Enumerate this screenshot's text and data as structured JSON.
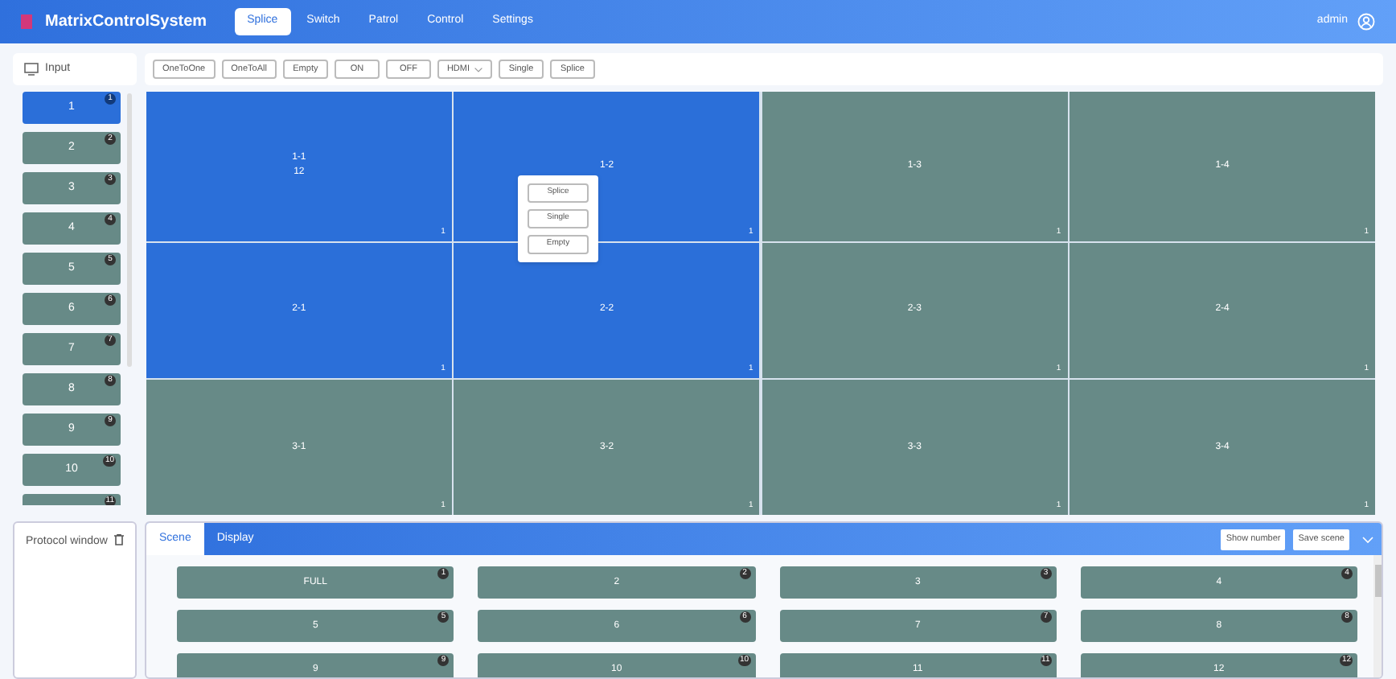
{
  "header": {
    "title": "MatrixControlSystem",
    "tabs": [
      {
        "label": "Splice",
        "selected": true
      },
      {
        "label": "Switch",
        "selected": false
      },
      {
        "label": "Patrol",
        "selected": false
      },
      {
        "label": "Control",
        "selected": false
      },
      {
        "label": "Settings",
        "selected": false
      }
    ],
    "user": "admin"
  },
  "input_panel": {
    "title": "Input",
    "items": [
      {
        "label": "1",
        "badge": "1",
        "selected": true
      },
      {
        "label": "2",
        "badge": "2",
        "selected": false
      },
      {
        "label": "3",
        "badge": "3",
        "selected": false
      },
      {
        "label": "4",
        "badge": "4",
        "selected": false
      },
      {
        "label": "5",
        "badge": "5",
        "selected": false
      },
      {
        "label": "6",
        "badge": "6",
        "selected": false
      },
      {
        "label": "7",
        "badge": "7",
        "selected": false
      },
      {
        "label": "8",
        "badge": "8",
        "selected": false
      },
      {
        "label": "9",
        "badge": "9",
        "selected": false
      },
      {
        "label": "10",
        "badge": "10",
        "selected": false
      },
      {
        "badge": "11",
        "selected": false
      }
    ]
  },
  "toolbar": [
    {
      "kind": "button",
      "label": "OneToOne"
    },
    {
      "kind": "button",
      "label": "OneToAll"
    },
    {
      "kind": "button",
      "label": "Empty"
    },
    {
      "kind": "button",
      "label": "ON"
    },
    {
      "kind": "button",
      "label": "OFF"
    },
    {
      "kind": "select",
      "label": "HDMI"
    },
    {
      "kind": "button",
      "label": "Single"
    },
    {
      "kind": "button",
      "label": "Splice"
    }
  ],
  "wall": {
    "cells": [
      {
        "label": "1-1",
        "source": "12",
        "count": "1",
        "selected": true
      },
      {
        "label": "1-2",
        "count": "1",
        "selected": true
      },
      {
        "label": "1-3",
        "count": "1",
        "selected": false
      },
      {
        "label": "1-4",
        "count": "1",
        "selected": false
      },
      {
        "label": "2-1",
        "count": "1",
        "selected": true
      },
      {
        "label": "2-2",
        "count": "1",
        "selected": true
      },
      {
        "label": "2-3",
        "count": "1",
        "selected": false
      },
      {
        "label": "2-4",
        "count": "1",
        "selected": false
      },
      {
        "label": "3-1",
        "count": "1",
        "selected": false
      },
      {
        "label": "3-2",
        "count": "1",
        "selected": false
      },
      {
        "label": "3-3",
        "count": "1",
        "selected": false
      },
      {
        "label": "3-4",
        "count": "1",
        "selected": false
      }
    ],
    "context_menu": [
      "Splice",
      "Single",
      "Empty"
    ]
  },
  "protocol_window": {
    "title": "Protocol window"
  },
  "scene_panel": {
    "tabs": [
      {
        "label": "Scene",
        "selected": true
      },
      {
        "label": "Display",
        "selected": false
      }
    ],
    "buttons": [
      "Show number",
      "Save scene"
    ],
    "scenes": [
      {
        "label": "FULL",
        "badge": "1"
      },
      {
        "label": "2",
        "badge": "2"
      },
      {
        "label": "3",
        "badge": "3"
      },
      {
        "label": "4",
        "badge": "4"
      },
      {
        "label": "5",
        "badge": "5"
      },
      {
        "label": "6",
        "badge": "6"
      },
      {
        "label": "7",
        "badge": "7"
      },
      {
        "label": "8",
        "badge": "8"
      },
      {
        "label": "9",
        "badge": "9"
      },
      {
        "label": "10",
        "badge": "10"
      },
      {
        "label": "11",
        "badge": "11"
      },
      {
        "label": "12",
        "badge": "12"
      }
    ]
  }
}
